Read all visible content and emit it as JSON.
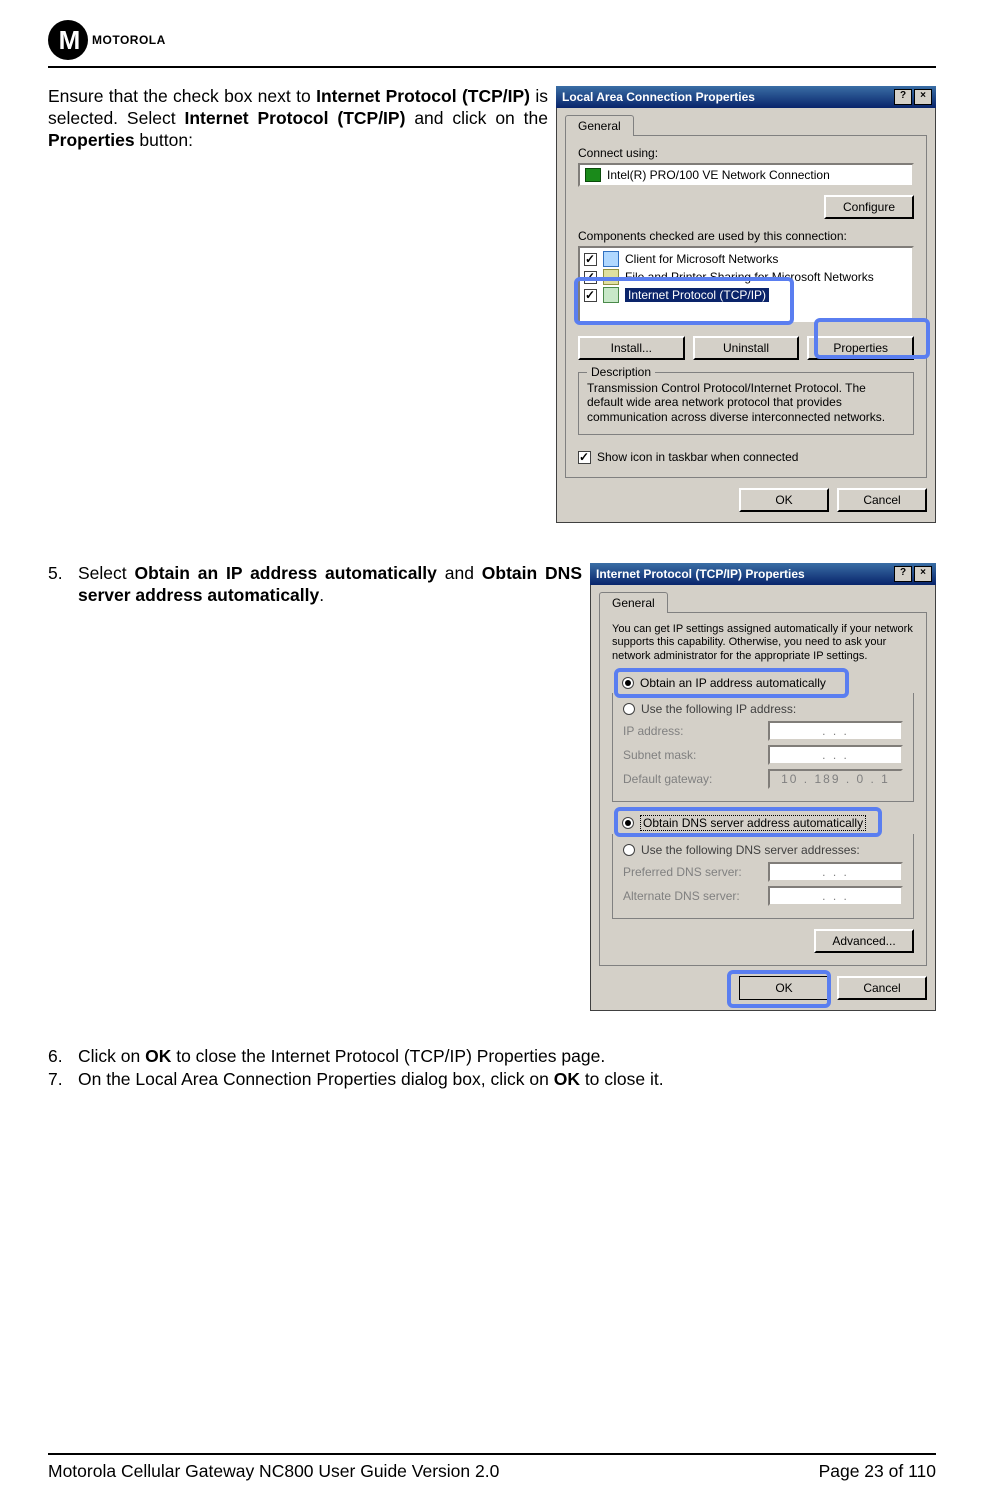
{
  "logo_text": "MOTOROLA",
  "intro": {
    "p1": "Ensure that the check box next to ",
    "b1": "Internet Protocol (TCP/IP)",
    "p2": " is selected. Select ",
    "b2": "Internet Protocol (TCP/IP)",
    "p3": " and click on the ",
    "b3": "Properties",
    "p4": " button:"
  },
  "dlg1": {
    "title": "Local Area Connection Properties",
    "help_btn": "?",
    "close_btn": "×",
    "tab": "General",
    "connect_using_label": "Connect using:",
    "adapter": "Intel(R) PRO/100 VE Network Connection",
    "configure": "Configure",
    "components_label": "Components checked are used by this connection:",
    "items": [
      "Client for Microsoft Networks",
      "File and Printer Sharing for Microsoft Networks",
      "Internet Protocol (TCP/IP)"
    ],
    "install": "Install...",
    "uninstall": "Uninstall",
    "properties": "Properties",
    "desc_legend": "Description",
    "desc": "Transmission Control Protocol/Internet Protocol. The default wide area network protocol that provides communication across diverse interconnected networks.",
    "show_icon": "Show icon in taskbar when connected",
    "ok": "OK",
    "cancel": "Cancel"
  },
  "step5": {
    "num": "5.",
    "p1": "Select ",
    "b1": "Obtain an IP address automatically",
    "p2": " and ",
    "b2": "Obtain DNS server address automatically",
    "p3": "."
  },
  "dlg2": {
    "title": "Internet Protocol (TCP/IP) Properties",
    "help_btn": "?",
    "close_btn": "×",
    "tab": "General",
    "info": "You can get IP settings assigned automatically if your network supports this capability. Otherwise, you need to ask your network administrator for the appropriate IP settings.",
    "r_auto_ip": "Obtain an IP address automatically",
    "r_use_ip": "Use the following IP address:",
    "ip_label": "IP address:",
    "subnet_label": "Subnet mask:",
    "gw_label": "Default gateway:",
    "gw_value": "10 . 189 .  0  .  1",
    "dots": ".     .     .",
    "r_auto_dns": "Obtain DNS server address automatically",
    "r_use_dns": "Use the following DNS server addresses:",
    "pref_dns": "Preferred DNS server:",
    "alt_dns": "Alternate DNS server:",
    "advanced": "Advanced...",
    "ok": "OK",
    "cancel": "Cancel"
  },
  "step6": {
    "num": "6.",
    "p1": "Click on ",
    "b1": "OK",
    "p2": " to close the Internet Protocol (TCP/IP) Properties page."
  },
  "step7": {
    "num": "7.",
    "p1": "On the Local Area Connection Properties dialog box, click on ",
    "b1": "OK",
    "p2": " to close it."
  },
  "footer": {
    "left": "Motorola Cellular Gateway NC800 User Guide Version 2.0",
    "right": "Page 23 of 110"
  }
}
